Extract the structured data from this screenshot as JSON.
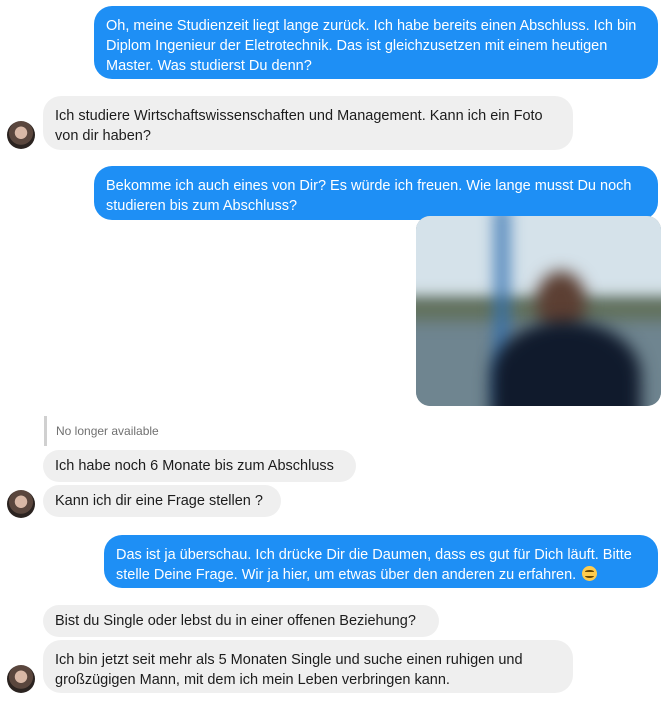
{
  "messages": {
    "m1": "Oh, meine Studienzeit liegt lange zurück. Ich habe bereits einen Abschluss. Ich bin Diplom Ingenieur der Eletrotechnik. Das ist gleichzusetzen mit einem heutigen Master. Was studierst Du denn?",
    "m2": "Ich studiere Wirtschaftswissenschaften und Management. Kann ich ein Foto von dir haben?",
    "m3": "Bekomme ich auch eines von Dir? Es würde ich freuen. Wie lange musst Du noch studieren bis zum Abschluss?",
    "reply_note": "No longer available",
    "m4": "Ich habe noch 6 Monate bis zum Abschluss",
    "m5": "Kann ich dir eine Frage stellen ?",
    "m6": "Das ist ja überschau. Ich drücke Dir die Daumen, dass es gut für Dich läuft. Bitte stelle Deine Frage. Wir ja hier, um etwas über den anderen zu erfahren.",
    "m7": "Bist du Single oder lebst du in einer offenen Beziehung?",
    "m8": "Ich bin jetzt seit mehr als 5 Monaten Single und suche einen ruhigen und großzügigen Mann, mit dem ich mein Leben verbringen kann."
  },
  "icons": {
    "avatar": "contact-avatar",
    "emoji": "smiling-face-emoji",
    "photo": "blurred-photo"
  },
  "colors": {
    "outgoing_bubble": "#1e8ff5",
    "incoming_bubble": "#efefef"
  }
}
